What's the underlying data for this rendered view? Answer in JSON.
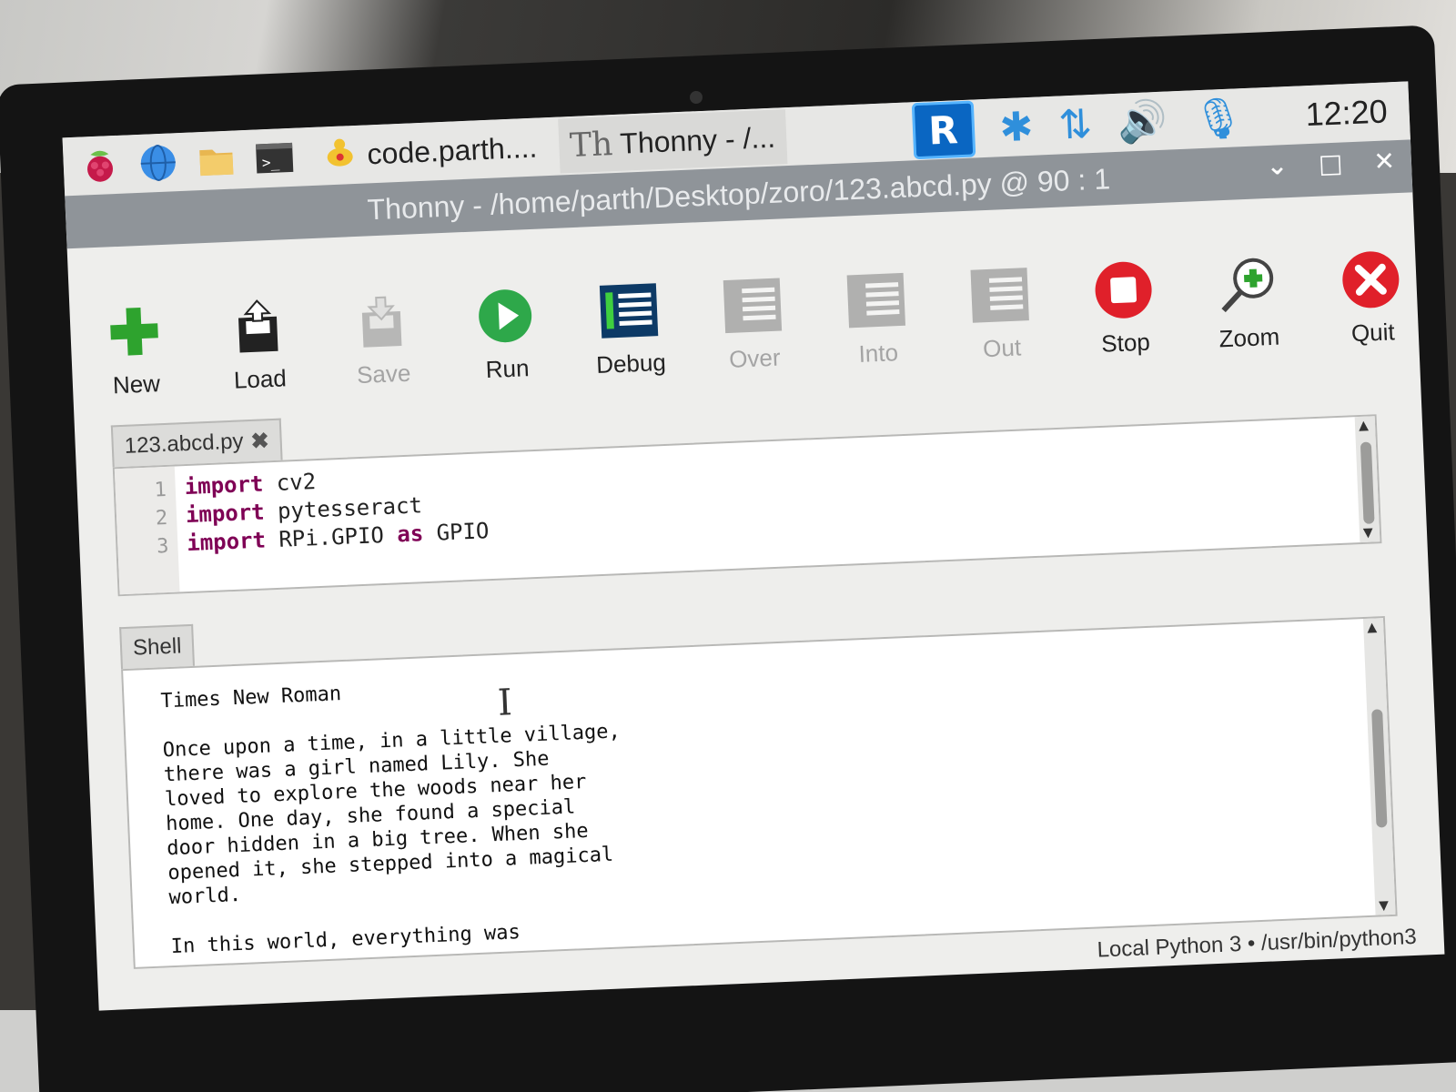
{
  "taskbar": {
    "tasks": [
      {
        "label": "code.parth...."
      },
      {
        "label": "Thonny  -  /..."
      }
    ],
    "clock": "12:20"
  },
  "window": {
    "title": "Thonny  -  /home/parth/Desktop/zoro/123.abcd.py  @  90 : 1"
  },
  "toolbar": {
    "new": "New",
    "load": "Load",
    "save": "Save",
    "run": "Run",
    "debug": "Debug",
    "over": "Over",
    "into": "Into",
    "out": "Out",
    "stop": "Stop",
    "zoom": "Zoom",
    "quit": "Quit"
  },
  "editor": {
    "tab": "123.abcd.py",
    "lines": [
      {
        "num": "1",
        "kw": "import",
        "rest": " cv2"
      },
      {
        "num": "2",
        "kw": "import",
        "rest": " pytesseract"
      },
      {
        "num": "3",
        "kw": "import",
        "rest": " RPi.GPIO ",
        "kw2": "as",
        "rest2": " GPIO"
      }
    ]
  },
  "shell": {
    "tab": "Shell",
    "output": "Times New Roman\n\nOnce upon a time, in a little village,\nthere was a girl named Lily. She\nloved to explore the woods near her\nhome. One day, she found a special\ndoor hidden in a big tree. When she\nopened it, she stepped into a magical\nworld.\n\nIn this world, everything was"
  },
  "status": {
    "interpreter": "Local Python 3  •  /usr/bin/python3"
  }
}
